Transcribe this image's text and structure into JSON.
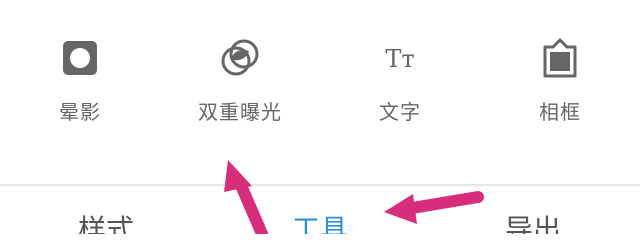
{
  "tools": {
    "items": [
      {
        "label": "晕影",
        "icon": "vignette-icon"
      },
      {
        "label": "双重曝光",
        "icon": "double-exposure-icon"
      },
      {
        "label": "文字",
        "icon": "text-icon",
        "icon_text": "Tт"
      },
      {
        "label": "相框",
        "icon": "frame-icon"
      }
    ]
  },
  "tabs": {
    "items": [
      {
        "label": "样式"
      },
      {
        "label": "工具"
      },
      {
        "label": "导出"
      }
    ],
    "active": "工具"
  },
  "colors": {
    "icon": "#666666",
    "label": "#666666",
    "active_tab": "#2d8fd6",
    "annotation_arrow": "#d62e7a",
    "divider": "#e6e6e6"
  }
}
